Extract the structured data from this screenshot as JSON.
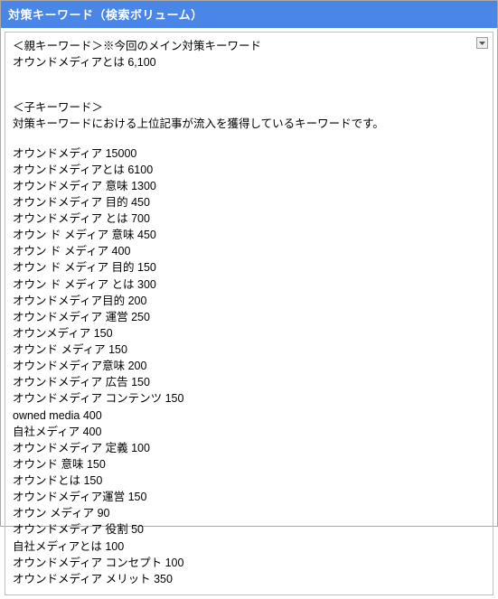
{
  "header": {
    "title": "対策キーワード（検索ボリューム）"
  },
  "body": {
    "parent_section": {
      "label": "＜親キーワード＞※今回のメイン対策キーワード",
      "keyword_line": "オウンドメディアとは 6,100"
    },
    "child_section": {
      "label": "＜子キーワード＞",
      "description": "対策キーワードにおける上位記事が流入を獲得しているキーワードです。"
    },
    "child_keywords": [
      "オウンドメディア 15000",
      "オウンドメディアとは 6100",
      "オウンドメディア 意味 1300",
      "オウンドメディア 目的 450",
      "オウンドメディア とは 700",
      "オウン ド メディア 意味 450",
      "オウン ド メディア 400",
      "オウン ド メディア 目的 150",
      "オウン ド メディア とは 300",
      "オウンドメディア目的 200",
      "オウンドメディア 運営 250",
      "オウンメディア 150",
      "オウンド メディア 150",
      "オウンドメディア意味 200",
      "オウンドメディア 広告 150",
      "オウンドメディア コンテンツ 150",
      "owned media 400",
      "自社メディア 400",
      "オウンドメディア 定義 100",
      "オウンド 意味 150",
      "オウンドとは 150",
      "オウンドメディア運営 150",
      "オウン メディア 90",
      "オウンドメディア 役割 50",
      "自社メディアとは 100",
      "オウンドメディア コンセプト 100",
      "オウンドメディア メリット 350"
    ]
  }
}
